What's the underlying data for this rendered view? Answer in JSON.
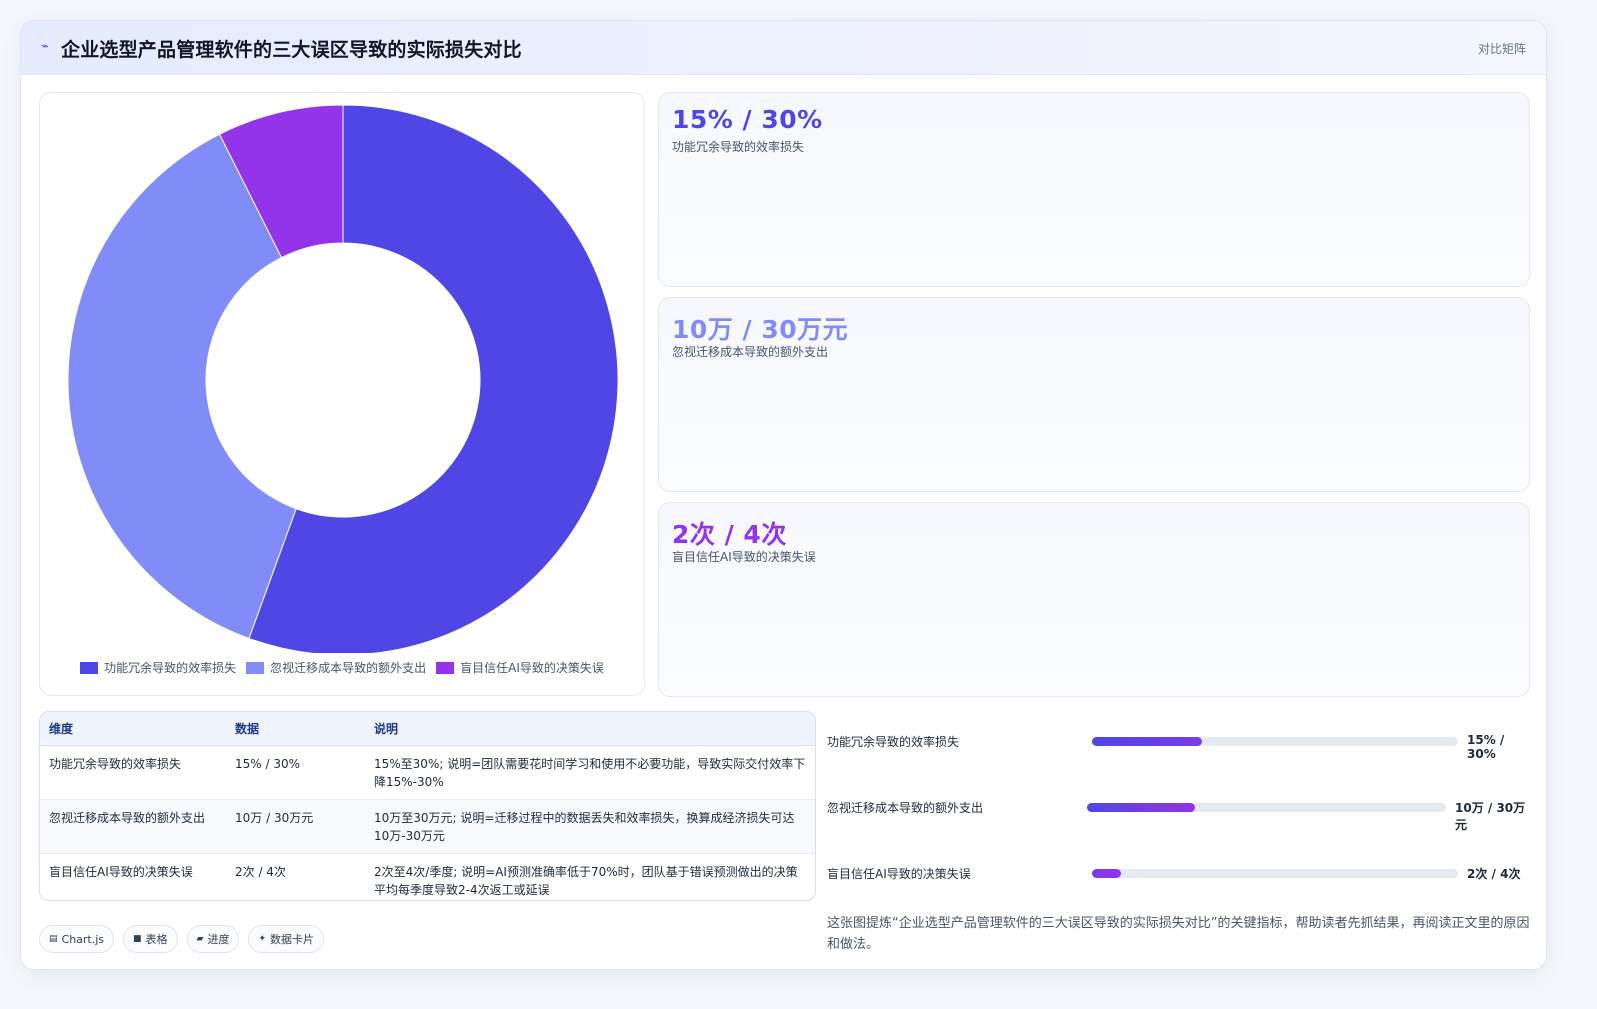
{
  "header": {
    "icon": "bolt-icon",
    "title": "企业选型产品管理软件的三大误区导致的实际损失对比",
    "tag": "对比矩阵"
  },
  "colors": {
    "series1": "#4f46e5",
    "series2": "#818cf8",
    "series3": "#9333ea"
  },
  "chart_data": {
    "type": "pie",
    "variant": "doughnut",
    "categories": [
      "功能冗余导致的效率损失",
      "忽视迁移成本导致的额外支出",
      "盲目信任AI导致的决策失误"
    ],
    "values": [
      15,
      10,
      2
    ],
    "legend_position": "bottom"
  },
  "kpis": [
    {
      "value": "15% / 30%",
      "label": "功能冗余导致的效率损失"
    },
    {
      "value": "10万 / 30万元",
      "label": "忽视迁移成本导致的额外支出"
    },
    {
      "value": "2次 / 4次",
      "label": "盲目信任AI导致的决策失误"
    }
  ],
  "table": {
    "headers": [
      "维度",
      "数据",
      "说明"
    ],
    "rows": [
      [
        "功能冗余导致的效率损失",
        "15% / 30%",
        "15%至30%; 说明=团队需要花时间学习和使用不必要功能，导致实际交付效率下降15%-30%"
      ],
      [
        "忽视迁移成本导致的额外支出",
        "10万 / 30万元",
        "10万至30万元; 说明=迁移过程中的数据丢失和效率损失，换算成经济损失可达10万-30万元"
      ],
      [
        "盲目信任AI导致的决策失误",
        "2次 / 4次",
        "2次至4次/季度; 说明=AI预测准确率低于70%时，团队基于错误预测做出的决策平均每季度导致2-4次返工或延误"
      ]
    ]
  },
  "chips": [
    {
      "icon": "chart-icon",
      "glyph": "▤",
      "label": "Chart.js"
    },
    {
      "icon": "table-icon",
      "glyph": "■",
      "label": "表格"
    },
    {
      "icon": "progress-icon",
      "glyph": "▰",
      "label": "进度"
    },
    {
      "icon": "sparkle-icon",
      "glyph": "✦",
      "label": "数据卡片"
    }
  ],
  "progress": [
    {
      "label": "功能冗余导致的效率损失",
      "value": "15% / 30%",
      "fraction": 0.3
    },
    {
      "label": "忽视迁移成本导致的额外支出",
      "value": "10万 / 30万元",
      "fraction": 0.3
    },
    {
      "label": "盲目信任AI导致的决策失误",
      "value": "2次 / 4次",
      "fraction": 0.08
    }
  ],
  "note": "这张图提炼“企业选型产品管理软件的三大误区导致的实际损失对比”的关键指标，帮助读者先抓结果，再阅读正文里的原因和做法。"
}
